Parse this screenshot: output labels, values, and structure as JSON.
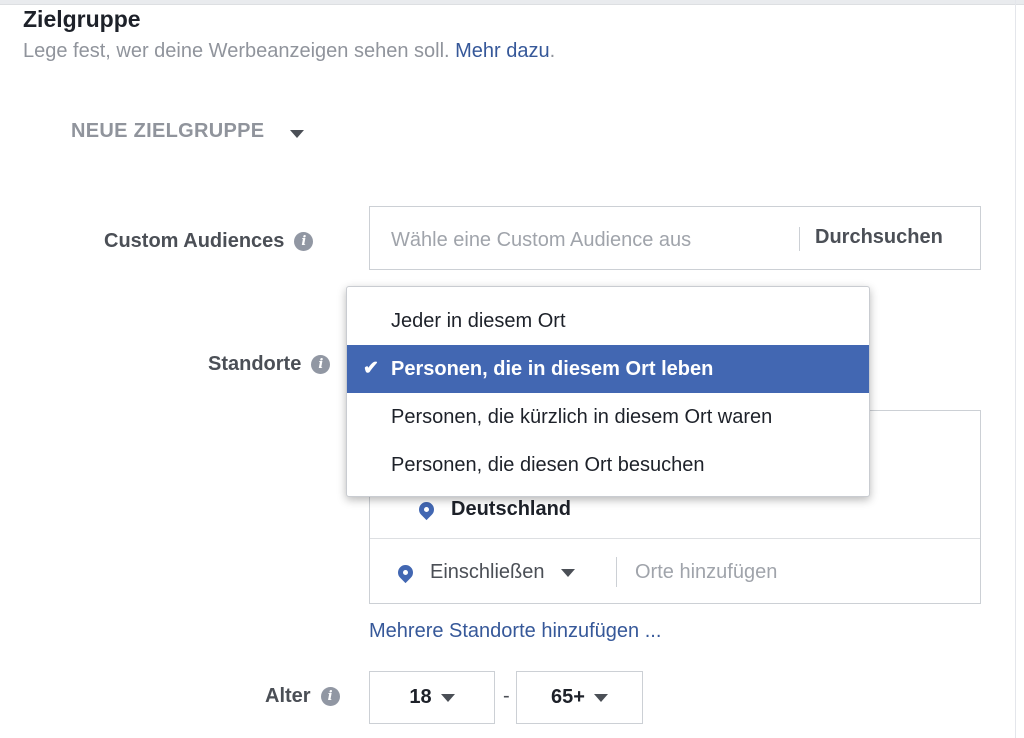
{
  "section": {
    "title": "Zielgruppe",
    "subtitle": "Lege fest, wer deine Werbeanzeigen sehen soll.",
    "learn_more": "Mehr dazu",
    "subtitle_end": "."
  },
  "audience_selector": {
    "label": "NEUE ZIELGRUPPE"
  },
  "custom_audiences": {
    "label": "Custom Audiences",
    "placeholder": "Wähle eine Custom Audience aus",
    "browse": "Durchsuchen"
  },
  "locations": {
    "label": "Standorte",
    "dropdown": {
      "options": [
        "Jeder in diesem Ort",
        "Personen, die in diesem Ort leben",
        "Personen, die kürzlich in diesem Ort waren",
        "Personen, die diesen Ort besuchen"
      ],
      "selected_index": 1,
      "check_glyph": "✔"
    },
    "selected_location": "Deutschland",
    "include_label": "Einschließen",
    "add_placeholder": "Orte hinzufügen",
    "add_multiple": "Mehrere Standorte hinzufügen ..."
  },
  "age": {
    "label": "Alter",
    "min": "18",
    "separator": "-",
    "max": "65+"
  },
  "colors": {
    "link": "#365899",
    "selected_bg": "#4267b2",
    "pin": "#4267b2"
  }
}
